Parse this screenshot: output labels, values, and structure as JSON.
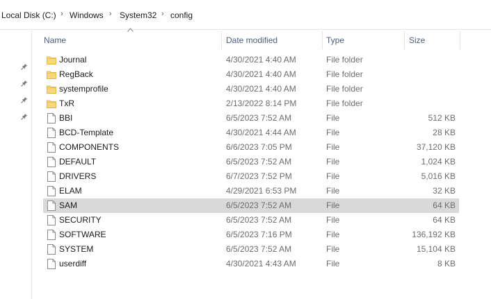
{
  "breadcrumb": {
    "items": [
      "Local Disk (C:)",
      "Windows",
      "System32",
      "config"
    ],
    "separator": "›"
  },
  "columns": {
    "name": "Name",
    "date": "Date modified",
    "type": "Type",
    "size": "Size"
  },
  "sort": {
    "column": "name",
    "direction": "ascending"
  },
  "rows": [
    {
      "name": "Journal",
      "date": "4/30/2021 4:40 AM",
      "type": "File folder",
      "size": "",
      "icon": "folder-icon",
      "selected": false
    },
    {
      "name": "RegBack",
      "date": "4/30/2021 4:40 AM",
      "type": "File folder",
      "size": "",
      "icon": "folder-icon",
      "selected": false
    },
    {
      "name": "systemprofile",
      "date": "4/30/2021 4:40 AM",
      "type": "File folder",
      "size": "",
      "icon": "folder-icon",
      "selected": false
    },
    {
      "name": "TxR",
      "date": "2/13/2022 8:14 PM",
      "type": "File folder",
      "size": "",
      "icon": "folder-icon",
      "selected": false
    },
    {
      "name": "BBI",
      "date": "6/5/2023 7:52 AM",
      "type": "File",
      "size": "512 KB",
      "icon": "file-icon",
      "selected": false
    },
    {
      "name": "BCD-Template",
      "date": "4/30/2021 4:44 AM",
      "type": "File",
      "size": "28 KB",
      "icon": "file-icon",
      "selected": false
    },
    {
      "name": "COMPONENTS",
      "date": "6/6/2023 7:05 PM",
      "type": "File",
      "size": "37,120 KB",
      "icon": "file-icon",
      "selected": false
    },
    {
      "name": "DEFAULT",
      "date": "6/5/2023 7:52 AM",
      "type": "File",
      "size": "1,024 KB",
      "icon": "file-icon",
      "selected": false
    },
    {
      "name": "DRIVERS",
      "date": "6/7/2023 7:52 PM",
      "type": "File",
      "size": "5,016 KB",
      "icon": "file-icon",
      "selected": false
    },
    {
      "name": "ELAM",
      "date": "4/29/2021 6:53 PM",
      "type": "File",
      "size": "32 KB",
      "icon": "file-icon",
      "selected": false
    },
    {
      "name": "SAM",
      "date": "6/5/2023 7:52 AM",
      "type": "File",
      "size": "64 KB",
      "icon": "file-icon",
      "selected": true
    },
    {
      "name": "SECURITY",
      "date": "6/5/2023 7:52 AM",
      "type": "File",
      "size": "64 KB",
      "icon": "file-icon",
      "selected": false
    },
    {
      "name": "SOFTWARE",
      "date": "6/5/2023 7:16 PM",
      "type": "File",
      "size": "136,192 KB",
      "icon": "file-icon",
      "selected": false
    },
    {
      "name": "SYSTEM",
      "date": "6/5/2023 7:52 AM",
      "type": "File",
      "size": "15,104 KB",
      "icon": "file-icon",
      "selected": false
    },
    {
      "name": "userdiff",
      "date": "4/30/2021 4:43 AM",
      "type": "File",
      "size": "8 KB",
      "icon": "file-icon",
      "selected": false
    }
  ],
  "quick_access_pins": [
    "pin-icon",
    "pin-icon",
    "pin-icon",
    "pin-icon"
  ],
  "colors": {
    "folder": "#f8d775",
    "folder_dark": "#e0b848",
    "selected_row": "#d9d9d9",
    "header_text": "#4c607a",
    "muted_text": "#6d6d6d"
  }
}
